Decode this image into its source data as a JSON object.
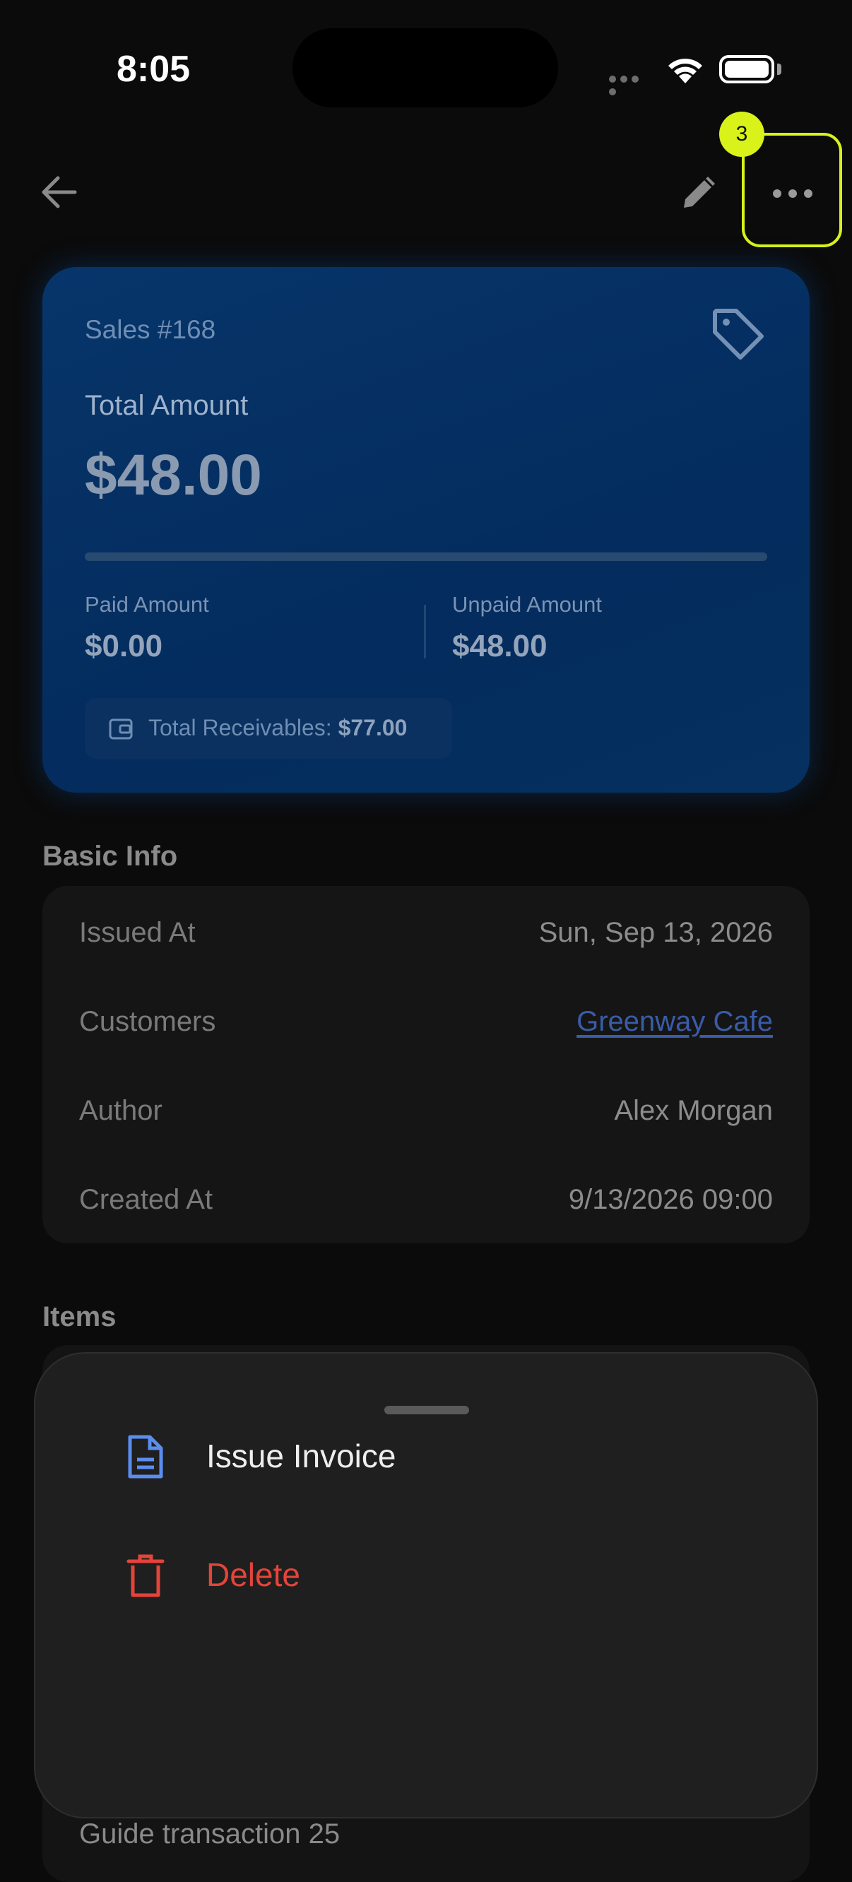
{
  "status_bar": {
    "time": "8:05"
  },
  "nav": {
    "badge_count": "3"
  },
  "card": {
    "title": "Sales #168",
    "total_label": "Total Amount",
    "total_value": "$48.00",
    "paid_progress_fraction": 0,
    "paid_label": "Paid Amount",
    "paid_value": "$0.00",
    "unpaid_label": "Unpaid Amount",
    "unpaid_value": "$48.00",
    "receivables_label": "Total Receivables:",
    "receivables_value": "$77.00"
  },
  "basic_info": {
    "title": "Basic Info",
    "rows": [
      {
        "label": "Issued At",
        "value": "Sun, Sep 13, 2026"
      },
      {
        "label": "Customers",
        "value": "Greenway Cafe"
      },
      {
        "label": "Author",
        "value": "Alex Morgan"
      },
      {
        "label": "Created At",
        "value": "9/13/2026 09:00"
      }
    ]
  },
  "items": {
    "title": "Items",
    "visible_item": "Guide transaction 25"
  },
  "sheet": {
    "items": [
      {
        "label": "Issue Invoice",
        "icon": "document-icon",
        "color": "#5b8def"
      },
      {
        "label": "Delete",
        "icon": "trash-icon",
        "color": "#e5443a"
      }
    ]
  },
  "colors": {
    "highlight": "#d8f21a",
    "card_bg": "#042c5e",
    "link": "#3a5ca8"
  }
}
